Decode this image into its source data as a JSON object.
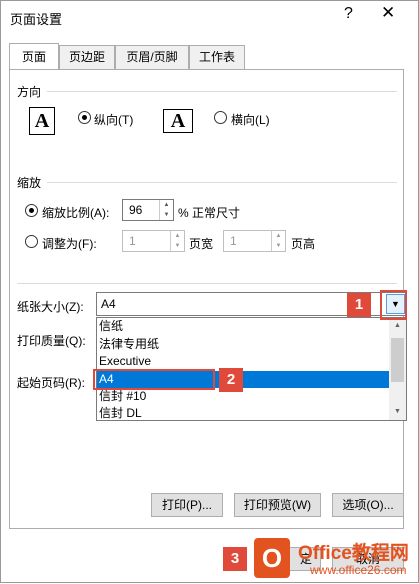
{
  "window": {
    "title": "页面设置",
    "help": "?",
    "close": "✕"
  },
  "tabs": [
    {
      "label": "页面"
    },
    {
      "label": "页边距"
    },
    {
      "label": "页眉/页脚"
    },
    {
      "label": "工作表"
    }
  ],
  "orientation": {
    "group_label": "方向",
    "portrait_icon": "A",
    "portrait_label": "纵向(T)",
    "landscape_icon": "A",
    "landscape_label": "横向(L)"
  },
  "scaling": {
    "group_label": "缩放",
    "adjust_label": "缩放比例(A):",
    "adjust_value": "96",
    "adjust_suffix": "% 正常尺寸",
    "fit_label": "调整为(F):",
    "fit_wide_value": "1",
    "fit_wide_suffix": "页宽",
    "fit_tall_value": "1",
    "fit_tall_suffix": "页高"
  },
  "paper": {
    "size_label": "纸张大小(Z):",
    "size_value": "A4",
    "quality_label": "打印质量(Q):",
    "first_page_label": "起始页码(R):",
    "options": [
      "信纸",
      "法律专用纸",
      "Executive",
      "A4",
      "信封 #10",
      "信封 DL"
    ],
    "selected_index": 3
  },
  "callouts": {
    "c1": "1",
    "c2": "2",
    "c3": "3"
  },
  "buttons": {
    "print": "打印(P)...",
    "preview": "打印预览(W)",
    "options": "选项(O)...",
    "ok_partial": "定",
    "cancel_partial": "取消"
  },
  "watermark": {
    "logo": "O",
    "line1": "Office教程网",
    "line2": "www.office26.com"
  },
  "colors": {
    "accent": "#0078d7",
    "callout": "#e04a3a",
    "watermark": "#e3531f"
  }
}
